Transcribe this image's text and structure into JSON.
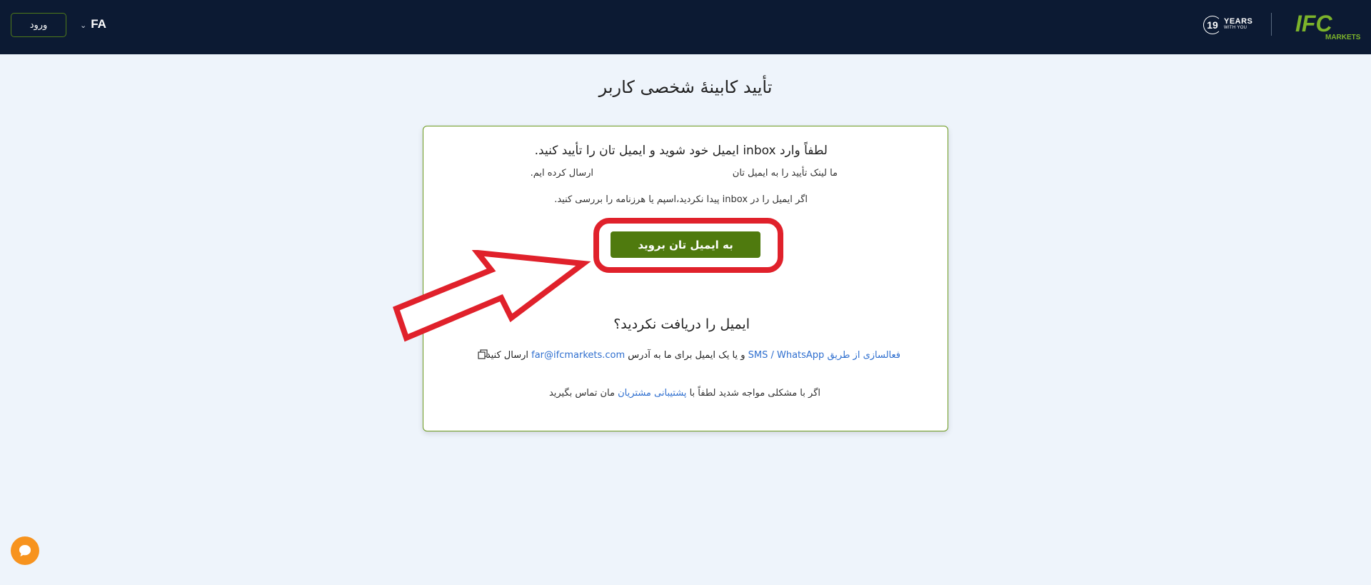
{
  "header": {
    "login_label": "ورود",
    "lang_code": "FA",
    "years_number": "19",
    "years_word": "YEARS",
    "years_sub": "WITH YOU",
    "logo_text": "IFC",
    "logo_sub": "MARKETS"
  },
  "page": {
    "title": "تأیید کابینۀ شخصی کاربر"
  },
  "card": {
    "line1": "لطفاً وارد inbox ایمیل خود شوید و ایمیل تان را تأیید کنید.",
    "line2_part1": "ما لینک تأیید را به ایمیل تان",
    "line2_part2": "ارسال کرده ایم.",
    "line3": "اگر ایمیل را در inbox پیدا نکردید،اسپم یا هرزنامه را بررسی کنید.",
    "go_button": "به ایمیل تان بروید",
    "subtitle": "ایمیل را دریافت نکردید؟",
    "line4_link1": "فعالسازی از طریق SMS / WhatsApp",
    "line4_mid": " و یا یک ایمیل برای ما به آدرس ",
    "line4_email": "far@ifcmarkets.com",
    "line4_end": " ارسال کنید",
    "line5_start": "اگر با مشکلی مواجه شدید لطفاً با ",
    "line5_link": "پشتیبانی مشتریان",
    "line5_end": " مان تماس بگیرید"
  },
  "colors": {
    "header_bg": "#0c1a33",
    "brand_green": "#4f7a0e",
    "annotation_red": "#e0212b",
    "link_blue": "#2f6fcf",
    "chat_orange": "#f7931e"
  }
}
